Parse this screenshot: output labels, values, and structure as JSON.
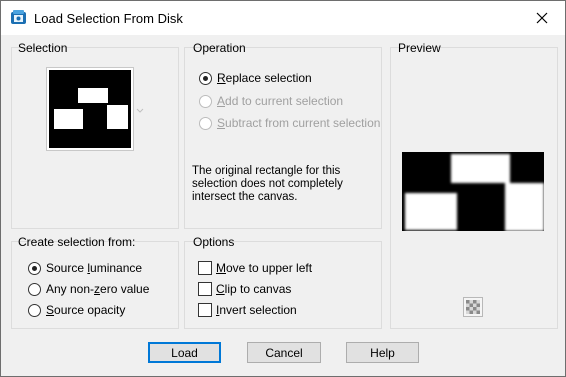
{
  "window": {
    "title": "Load Selection From Disk",
    "icon": "app-icon",
    "close_icon": "close-icon"
  },
  "selection": {
    "label": "Selection",
    "dropdown_icon": "chevron-down-icon"
  },
  "operation": {
    "label": "Operation",
    "options": [
      {
        "label": "Replace selection",
        "accel": "R",
        "rest": "eplace selection",
        "checked": true,
        "enabled": true
      },
      {
        "label": "Add to current selection",
        "accel": "A",
        "rest": "dd to current selection",
        "checked": false,
        "enabled": false
      },
      {
        "label": "Subtract from current selection",
        "accel": "S",
        "rest": "ubtract from current selection",
        "checked": false,
        "enabled": false
      }
    ],
    "message": "The original rectangle for this selection does not completely intersect the canvas."
  },
  "preview": {
    "label": "Preview",
    "zoom_icon": "checkerboard-icon"
  },
  "create_from": {
    "label": "Create selection from:",
    "options": [
      {
        "label": "Source luminance",
        "pre": "Source ",
        "accel": "l",
        "rest": "uminance",
        "checked": true
      },
      {
        "label": "Any non-zero value",
        "pre": "Any non-",
        "accel": "z",
        "rest": "ero value",
        "checked": false
      },
      {
        "label": "Source opacity",
        "pre": "",
        "accel": "S",
        "rest": "ource opacity",
        "checked": false
      }
    ]
  },
  "options": {
    "label": "Options",
    "items": [
      {
        "label": "Move to upper left",
        "accel": "M",
        "rest": "ove to upper left",
        "checked": false
      },
      {
        "label": "Clip to canvas",
        "accel": "C",
        "rest": "lip to canvas",
        "checked": false
      },
      {
        "label": "Invert selection",
        "accel": "I",
        "rest": "nvert selection",
        "checked": false
      }
    ]
  },
  "buttons": {
    "load": "Load",
    "cancel": "Cancel",
    "help": "Help"
  }
}
